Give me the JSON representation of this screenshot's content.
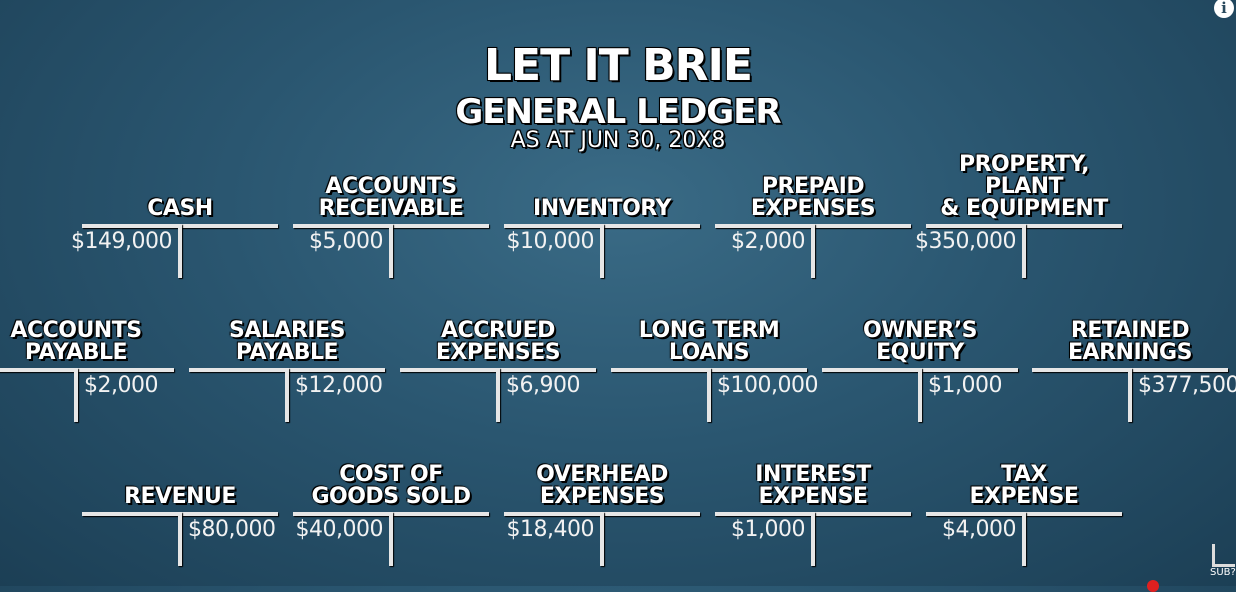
{
  "header": {
    "company": "LET IT BRIE",
    "report": "GENERAL LEDGER",
    "date": "AS AT JUN 30, 20X8"
  },
  "accounts": [
    {
      "name": "CASH",
      "side": "debit",
      "amount": "$149,000"
    },
    {
      "name": "ACCOUNTS\nRECEIVABLE",
      "side": "debit",
      "amount": "$5,000"
    },
    {
      "name": "INVENTORY",
      "side": "debit",
      "amount": "$10,000"
    },
    {
      "name": "PREPAID\nEXPENSES",
      "side": "debit",
      "amount": "$2,000"
    },
    {
      "name": "PROPERTY, PLANT\n& EQUIPMENT",
      "side": "debit",
      "amount": "$350,000"
    },
    {
      "name": "ACCOUNTS\nPAYABLE",
      "side": "credit",
      "amount": "$2,000"
    },
    {
      "name": "SALARIES\nPAYABLE",
      "side": "credit",
      "amount": "$12,000"
    },
    {
      "name": "ACCRUED\nEXPENSES",
      "side": "credit",
      "amount": "$6,900"
    },
    {
      "name": "LONG TERM\nLOANS",
      "side": "credit",
      "amount": "$100,000"
    },
    {
      "name": "OWNER’S\nEQUITY",
      "side": "credit",
      "amount": "$1,000"
    },
    {
      "name": "RETAINED\nEARNINGS",
      "side": "credit",
      "amount": "$377,500"
    },
    {
      "name": "REVENUE",
      "side": "credit",
      "amount": "$80,000"
    },
    {
      "name": "COST OF\nGOODS SOLD",
      "side": "debit",
      "amount": "$40,000"
    },
    {
      "name": "OVERHEAD\nEXPENSES",
      "side": "debit",
      "amount": "$18,400"
    },
    {
      "name": "INTEREST\nEXPENSE",
      "side": "debit",
      "amount": "$1,000"
    },
    {
      "name": "TAX\nEXPENSE",
      "side": "debit",
      "amount": "$4,000"
    }
  ],
  "overlay": {
    "info_icon": "info-icon",
    "info_glyph": "i",
    "subscribe_label": "SUB?"
  }
}
